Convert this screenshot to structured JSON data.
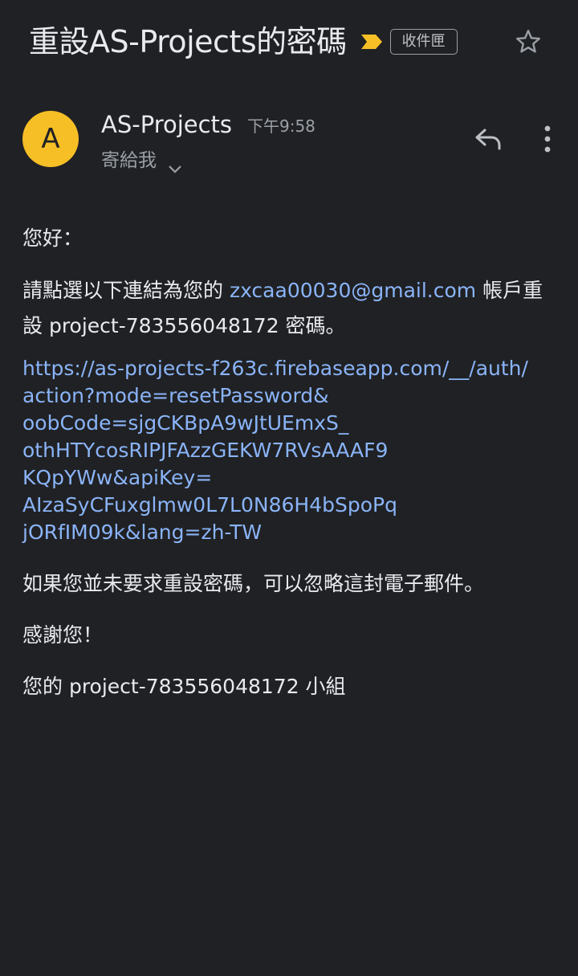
{
  "header": {
    "subject": "重設AS-Projects的密碼",
    "label": "收件匣"
  },
  "sender": {
    "initial": "A",
    "name": "AS-Projects",
    "time": "下午9:58",
    "recipient": "寄給我"
  },
  "body": {
    "greeting": "您好：",
    "para1_prefix": "請點選以下連結為您的 ",
    "email": "zxcaa00030@gmail.com",
    "para1_suffix": " 帳戶重設 project-783556048172 密碼。",
    "link_lines": [
      "https://as-projects-f263c.firebaseapp.com/__/auth/",
      "action?mode=resetPassword&",
      "oobCode=sjgCKBpA9wJtUEmxS_",
      "othHTYcosRIPJFAzzGEKW7RVsAAAF9",
      "KQpYWw&apiKey=",
      "AIzaSyCFuxglmw0L7L0N86H4bSpoPq",
      "jORfIM09k&lang=zh-TW"
    ],
    "para3": "如果您並未要求重設密碼，可以忽略這封電子郵件。",
    "para4": "感謝您！",
    "para5": "您的 project-783556048172 小組"
  },
  "colors": {
    "background": "#202124",
    "text": "#e8eaed",
    "link": "#8ab4f8",
    "avatar": "#f6bf26",
    "important_marker": "#f6bf26"
  },
  "icons": {
    "important": "important-marker-icon",
    "star": "star-icon",
    "chevron": "chevron-down-icon",
    "reply": "reply-icon",
    "more": "more-vert-icon"
  }
}
